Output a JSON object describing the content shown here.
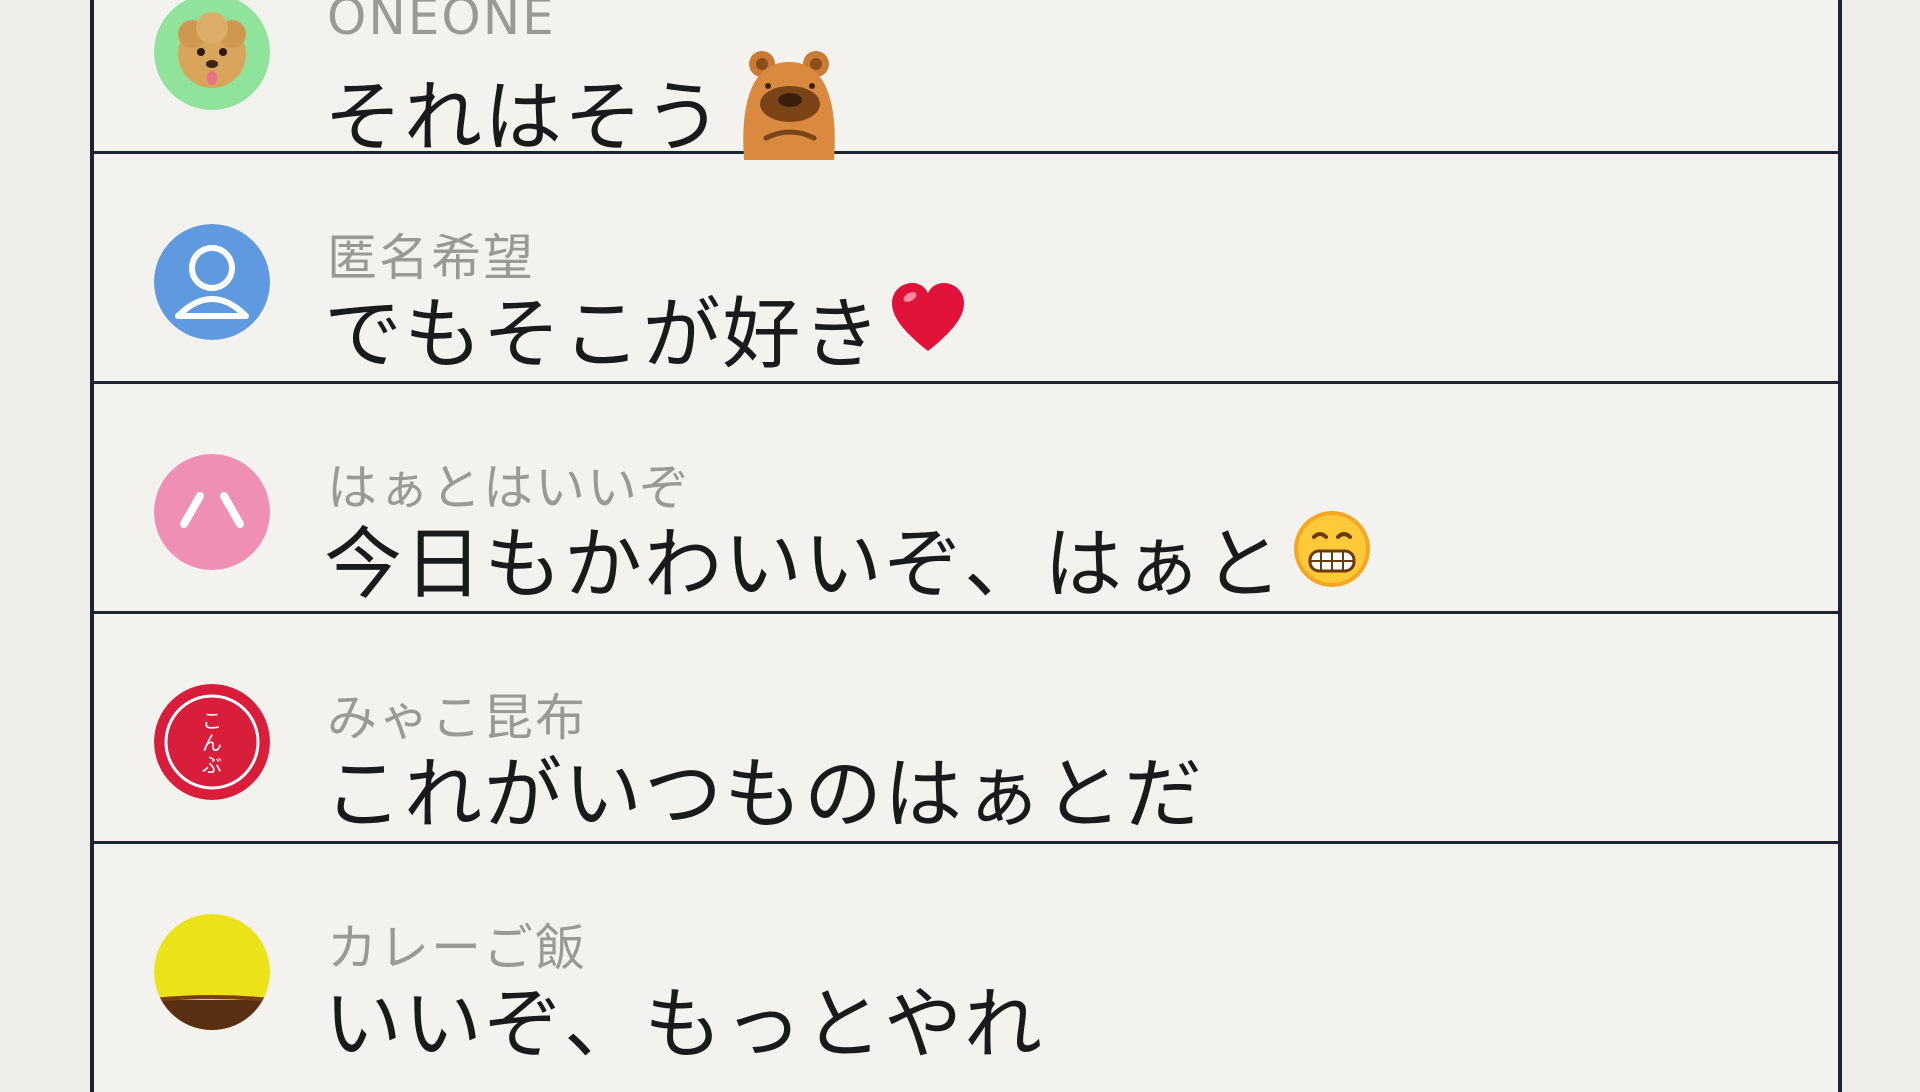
{
  "posts": [
    {
      "username": "ONEONE",
      "message": "それはそう",
      "avatar": "dog-avatar-icon",
      "avatar_bg": "#8fe39a",
      "emoji": "bear-sticker-icon"
    },
    {
      "username": "匿名希望",
      "message": "でもそこが好き",
      "avatar": "default-person-avatar-icon",
      "avatar_bg": "#5f9ae0",
      "emoji": "heart-icon"
    },
    {
      "username": "はぁとはいいぞ",
      "message": "今日もかわいいぞ、はぁと",
      "avatar": "pink-face-avatar-icon",
      "avatar_bg": "#ef8fb4",
      "emoji": "grinning-face-icon"
    },
    {
      "username": "みゃこ昆布",
      "message": "これがいつものはぁとだ",
      "avatar": "kombu-seal-avatar-icon",
      "avatar_bg": "#d81e3a",
      "avatar_text": "こんぶ",
      "emoji": ""
    },
    {
      "username": "カレーご飯",
      "message": "いいぞ、もっとやれ",
      "avatar": "curry-avatar-icon",
      "avatar_bg": "#ece21a",
      "emoji": ""
    }
  ],
  "colors": {
    "background": "#eeede8",
    "divider": "#1c2433",
    "username": "#9a9996",
    "message": "#1a1a1a"
  }
}
